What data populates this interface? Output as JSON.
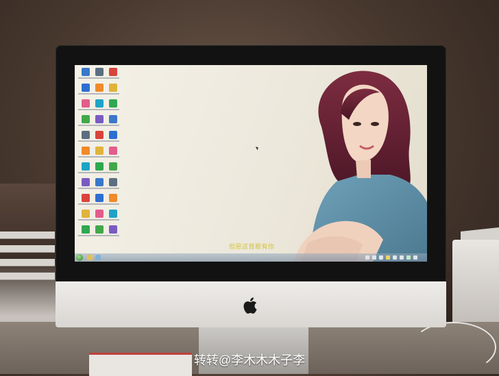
{
  "screen": {
    "caption": "但愿这首歌有你",
    "taskbar": {
      "start_icon": "windows-start-orb-icon",
      "pinned_icons": [
        "folder-icon",
        "app-icon"
      ]
    },
    "desktop_icon_count": 33
  },
  "device": {
    "logo": "apple-logo-icon"
  },
  "watermark": {
    "text": "转转@李木木木子李"
  },
  "colors": {
    "bezel": "#121212",
    "chin": "#e6e3df",
    "caption": "#d4c23a",
    "hair": "#6a2236",
    "shirt": "#5e8fa8"
  }
}
